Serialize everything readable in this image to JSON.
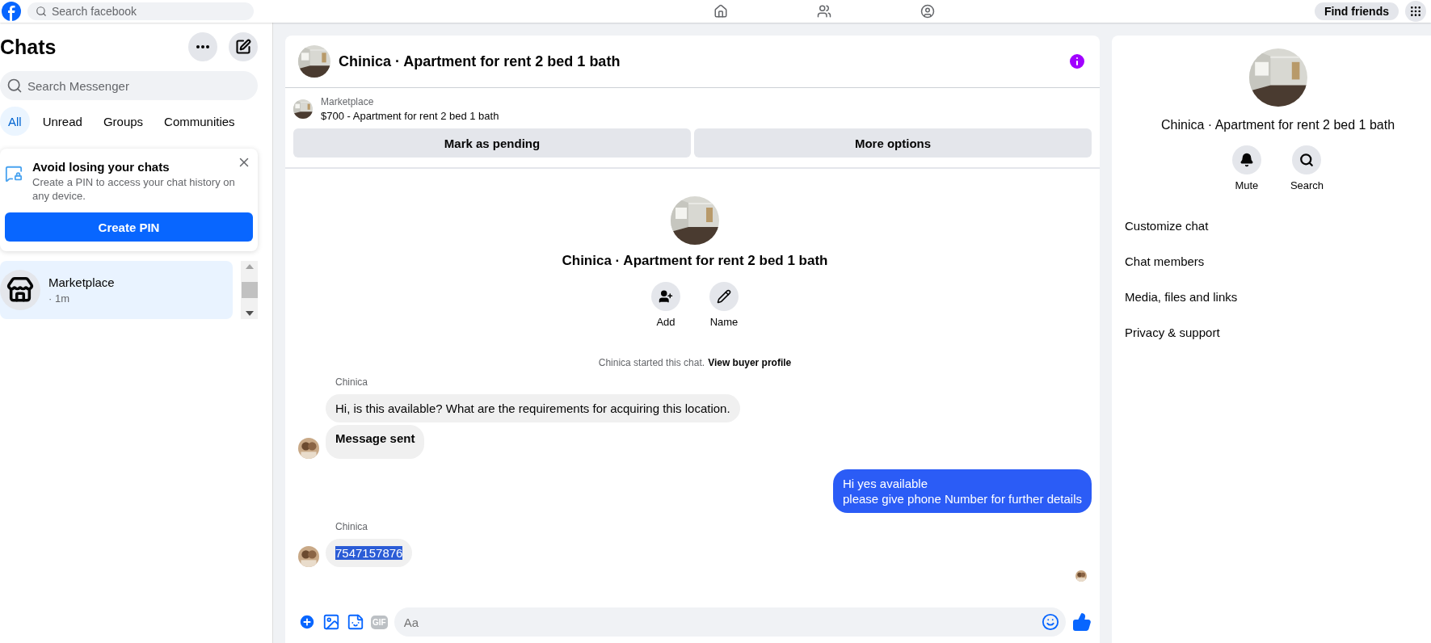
{
  "top_bar": {
    "search": {
      "placeholder": "Search facebook"
    },
    "find_friends": "Find friends"
  },
  "sidebar": {
    "title": "Chats",
    "search": {
      "placeholder": "Search Messenger"
    },
    "filters": [
      {
        "label": "All",
        "selected": true
      },
      {
        "label": "Unread",
        "selected": false
      },
      {
        "label": "Groups",
        "selected": false
      },
      {
        "label": "Communities",
        "selected": false
      }
    ],
    "pin_card": {
      "title": "Avoid losing your chats",
      "text": "Create a PIN to access your chat history on any device.",
      "button": "Create PIN"
    },
    "chats": [
      {
        "name": "Marketplace",
        "time": "· 1m",
        "selected": true
      }
    ]
  },
  "conversation": {
    "title": "Chinica · Apartment for rent 2 bed 1 bath",
    "listing": {
      "source": "Marketplace",
      "title": "$700 - Apartment for rent 2 bed 1 bath"
    },
    "actions": [
      "Mark as pending",
      "More options"
    ],
    "intro": {
      "title": "Chinica · Apartment for rent 2 bed 1 bath",
      "buttons": [
        {
          "kind": "add",
          "label": "Add"
        },
        {
          "kind": "name",
          "label": "Name"
        }
      ],
      "notice": "Chinica started this chat.",
      "link": "View buyer profile"
    },
    "messages": [
      {
        "sender": "Chinica",
        "outgoing": false,
        "bubbles": [
          {
            "kind": "text",
            "text": "Hi, is this available? What are the requirements for acquiring this location.",
            "highlighted": false
          },
          {
            "kind": "notice",
            "text": "Message sent",
            "highlighted": false
          }
        ]
      },
      {
        "outgoing": true,
        "bubbles": [
          {
            "kind": "text",
            "text": "Hi yes available\nplease give phone Number for further details",
            "highlighted": false
          }
        ]
      },
      {
        "sender": "Chinica",
        "outgoing": false,
        "bubbles": [
          {
            "kind": "text",
            "text": "7547157876",
            "highlighted": true
          }
        ]
      }
    ],
    "composer": {
      "gif_label": "GIF",
      "placeholder": "Aa"
    }
  },
  "details": {
    "title": "Chinica · Apartment for rent 2 bed 1 bath",
    "actions": [
      {
        "kind": "mute",
        "label": "Mute"
      },
      {
        "kind": "search",
        "label": "Search"
      }
    ],
    "items": [
      "Customize chat",
      "Chat members",
      "Media, files and links",
      "Privacy & support"
    ]
  }
}
